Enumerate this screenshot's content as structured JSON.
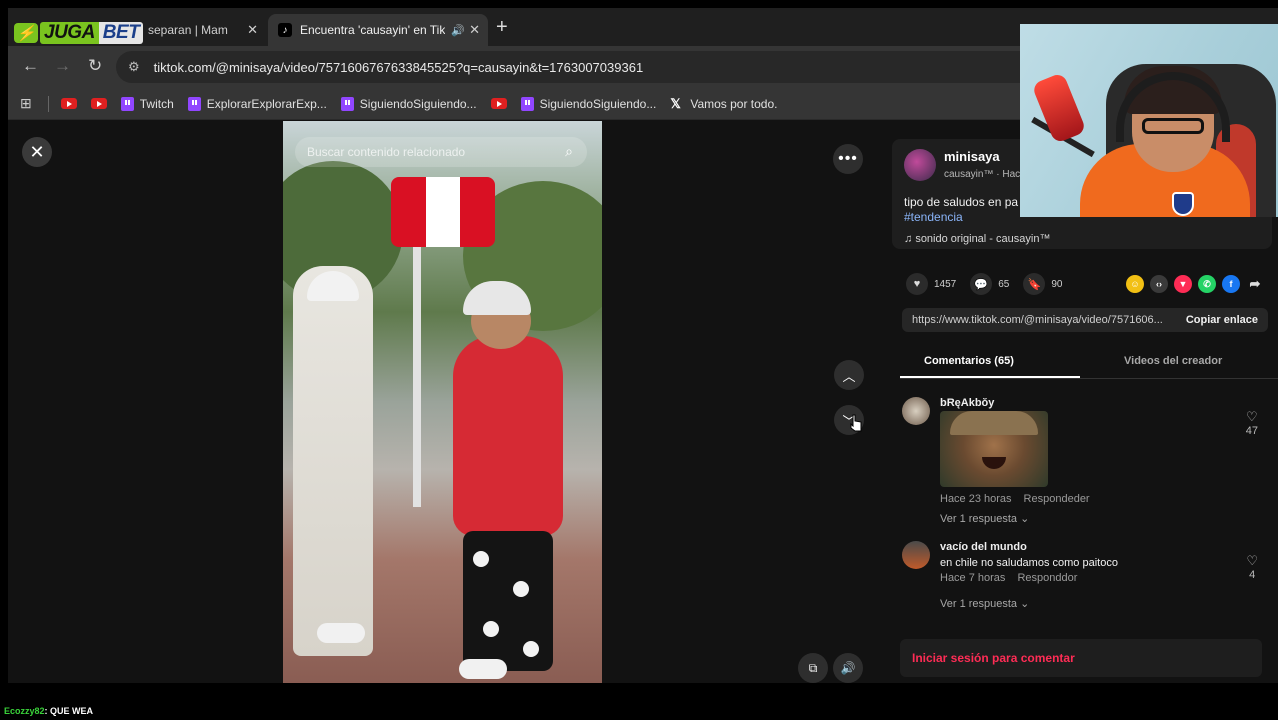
{
  "brand": {
    "part1": "JUGA",
    "part2": "BET"
  },
  "tabs": [
    {
      "label": "separan | Mam",
      "close": "✕"
    },
    {
      "label": "Encuentra 'causayin' en Tik",
      "close": "✕"
    }
  ],
  "new_tab": "+",
  "address": {
    "url": "tiktok.com/@minisaya/video/7571606767633845525?q=causayin&t=1763007039361"
  },
  "bookmarks": [
    {
      "type": "youtube",
      "label": ""
    },
    {
      "type": "youtube",
      "label": ""
    },
    {
      "type": "twitch",
      "label": "Twitch"
    },
    {
      "type": "twitch",
      "label": "ExplorarExplorarExp..."
    },
    {
      "type": "twitch",
      "label": "SiguiendoSiguiendo..."
    },
    {
      "type": "youtube",
      "label": ""
    },
    {
      "type": "twitch",
      "label": "SiguiendoSiguiendo..."
    },
    {
      "type": "x",
      "label": "Vamos por todo."
    }
  ],
  "video": {
    "search_placeholder": "Buscar contenido relacionado",
    "flag_colors": [
      "#d91023",
      "#ffffff",
      "#d91023"
    ]
  },
  "post": {
    "username": "minisaya",
    "subline": "causayin™ · Hac",
    "description": "tipo de saludos en pa",
    "hashtag": "#tendencia",
    "sound": "sonido original - causayin™",
    "likes": "1457",
    "comments": "65",
    "saves": "90",
    "link": "https://www.tiktok.com/@minisaya/video/7571606...",
    "copy_label": "Copiar enlace",
    "share_colors": [
      "#f2c014",
      "#3a3a3a",
      "#fe2c55",
      "#25d366",
      "#1877f2"
    ]
  },
  "panel_tabs": {
    "comments_tab": "Comentarios (65)",
    "creator_videos_tab": "Videos del creador"
  },
  "comments": [
    {
      "name": "bRęAkbŏy",
      "text": "",
      "time": "Hace 23 horas",
      "reply": "Respondeder",
      "replies": "Ver 1 respuesta ⌄",
      "likes": "47"
    },
    {
      "name": "vacío del mundo",
      "text": "en chile no saludamos como paitoco",
      "time": "Hace 7 horas",
      "reply": "Responddor",
      "replies": "Ver 1 respuesta ⌄",
      "likes": "4"
    }
  ],
  "login_prompt": "Iniciar sesión para comentar",
  "chat": {
    "user": "Ecozzy82",
    "message": ": QUE WEA"
  },
  "colors": {
    "tiktok_red": "#fe2c55",
    "link_blue": "#8ab4f8",
    "brand_green": "#7ac41f"
  }
}
